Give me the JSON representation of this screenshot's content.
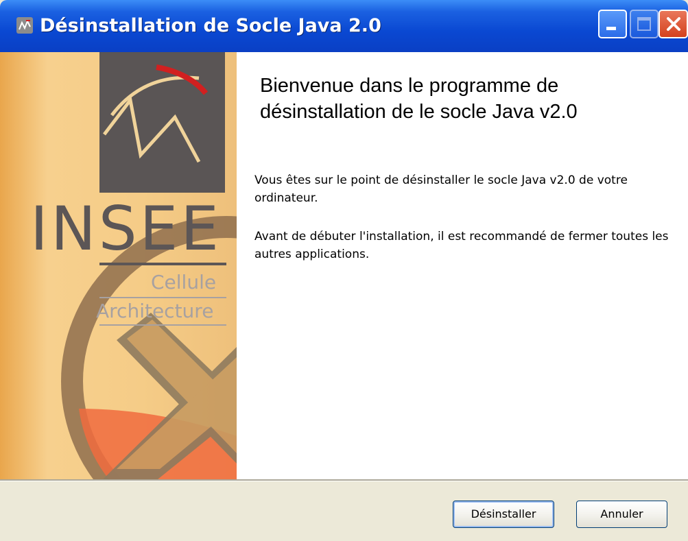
{
  "window": {
    "title": "Désinstallation de Socle Java 2.0"
  },
  "banner": {
    "logo_text": "INSEE",
    "subtitle_line1": "Cellule",
    "subtitle_line2": "Architecture"
  },
  "content": {
    "heading": "Bienvenue dans le programme de désinstallation de le socle Java v2.0",
    "paragraph1": "Vous êtes sur le point de désinstaller le socle Java v2.0 de votre ordinateur.",
    "paragraph2": "Avant de débuter l'installation, il est recommandé de fermer toutes les autres applications."
  },
  "buttons": {
    "uninstall": "Désinstaller",
    "cancel": "Annuler"
  },
  "icons": {
    "app": "installer-icon",
    "minimize": "minimize-icon",
    "maximize": "maximize-icon",
    "close": "close-icon",
    "banner_mark": "uninstall-cross-icon"
  },
  "colors": {
    "titlebar": "#0a48d2",
    "close_button": "#d4411e",
    "banner_background": "#f5cc87",
    "content_background": "#ffffff",
    "dialog_background": "#ece9d8"
  }
}
